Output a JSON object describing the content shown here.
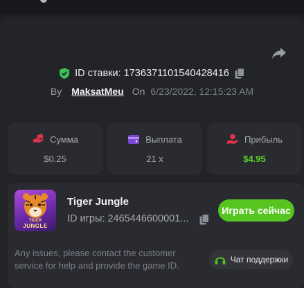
{
  "bet": {
    "id_label": "ID ставки: 1736371101540428416",
    "by_label": "By",
    "username": "MaksatMeu",
    "on_label": "On",
    "date": "6/23/2022, 12:15:23 AM"
  },
  "stats": [
    {
      "label": "Сумма",
      "value": "$0.25",
      "icon": "money-hand-icon"
    },
    {
      "label": "Выплата",
      "value": "21 x",
      "icon": "wallet-icon"
    },
    {
      "label": "Прибыль",
      "value": "$4.95",
      "icon": "profit-hand-icon"
    }
  ],
  "game": {
    "title": "Tiger Jungle",
    "id_label": "ID игры: 2465446600001...",
    "thumb_title_top": "TIGER",
    "thumb_title_bottom": "JUNGLE",
    "play_label": "Играть сейчас"
  },
  "note": "Any issues, please contact the customer service for help and provide the game ID.",
  "support_label": "Чат поддержки",
  "colors": {
    "accent_green": "#56c51f",
    "profit_green": "#5fd12c",
    "shield_green": "#3cc25a",
    "stat_icon_red": "#e0344e",
    "stat_icon_purple": "#7b45d6"
  }
}
